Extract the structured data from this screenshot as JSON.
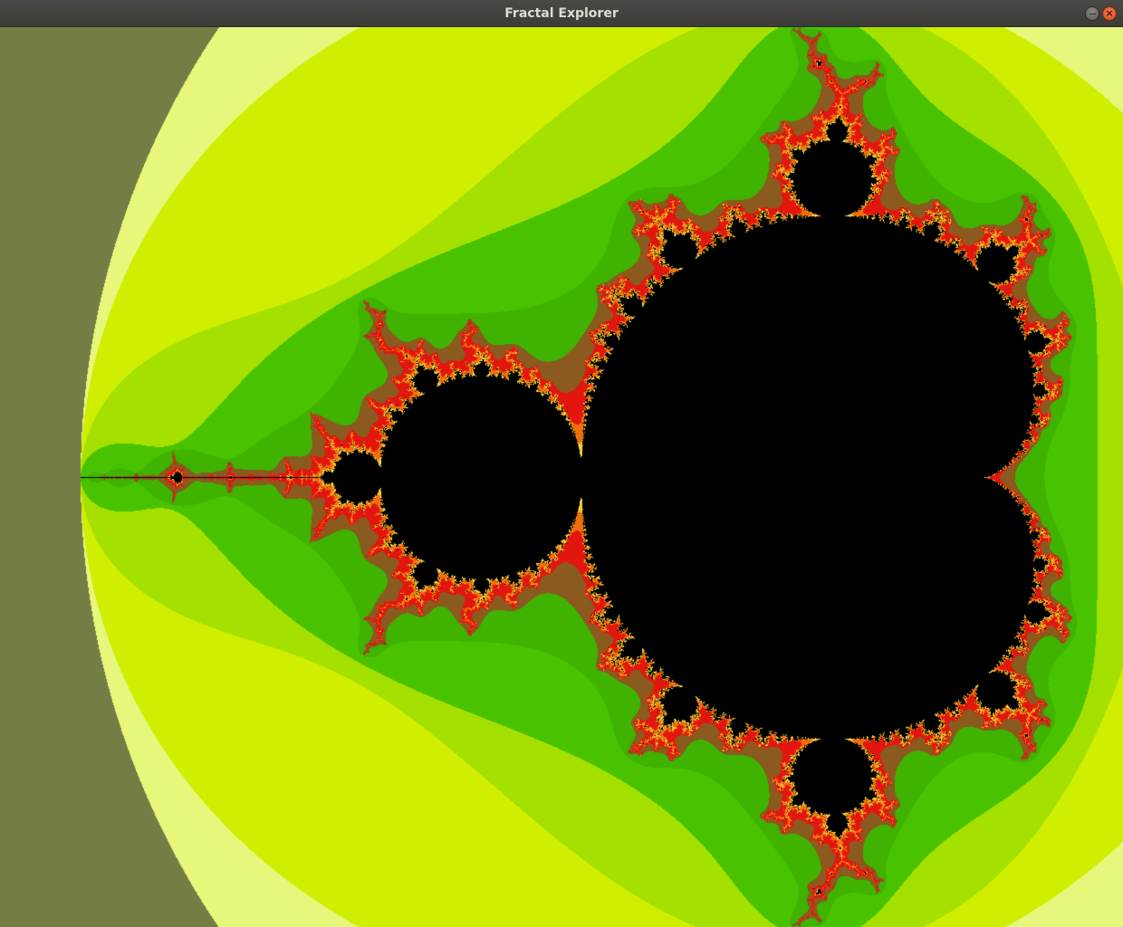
{
  "window": {
    "title": "Fractal Explorer",
    "controls": {
      "minimize_icon": "minimize-icon",
      "close_icon": "close-icon",
      "close_glyph": "×"
    }
  },
  "fractal": {
    "type": "mandelbrot",
    "view": {
      "center_re": -0.8,
      "center_im": 0.0,
      "span_re": 2.8
    },
    "max_iterations": 60,
    "palette": {
      "inside": "#000000",
      "outer_bands": [
        "#747d44",
        "#e6f77c",
        "#cfee00",
        "#a4e000",
        "#49c300",
        "#3fb300",
        "#8a5a1e",
        "#e2160f",
        "#f26c0a",
        "#f7d13a"
      ]
    }
  }
}
